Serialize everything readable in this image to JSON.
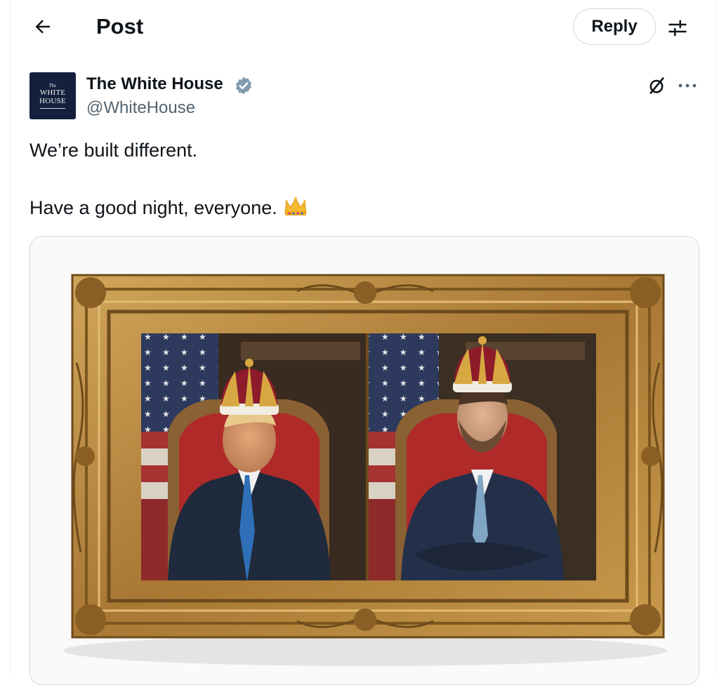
{
  "header": {
    "back_icon": "arrow-left-icon",
    "title": "Post",
    "reply_label": "Reply",
    "settings_icon": "sliders-icon"
  },
  "author": {
    "avatar_text_small": "The",
    "avatar_text_line1": "WHITE",
    "avatar_text_line2": "HOUSE",
    "name": "The White House",
    "verified_icon": "verified-badge-icon",
    "handle": "@WhiteHouse",
    "grok_icon": "grok-icon",
    "more_icon": "more-icon"
  },
  "tweet": {
    "line1": "We’re built different.",
    "line2": "Have a good night, everyone.",
    "emoji": "crown-emoji"
  },
  "media": {
    "icon": "framed-portrait-image",
    "colors": {
      "frame": "#b8893e",
      "frame_dark": "#6e4b1c",
      "jacket": "#1f2a3c",
      "tie_left": "#2f6fb7",
      "tie_right": "#7fa6c4",
      "throne": "#b02a2a",
      "crown_red": "#8e1b2a"
    }
  },
  "colors": {
    "text": "#0f1419",
    "secondary": "#536471",
    "border": "#cfd9de",
    "verified": "#829aab"
  }
}
